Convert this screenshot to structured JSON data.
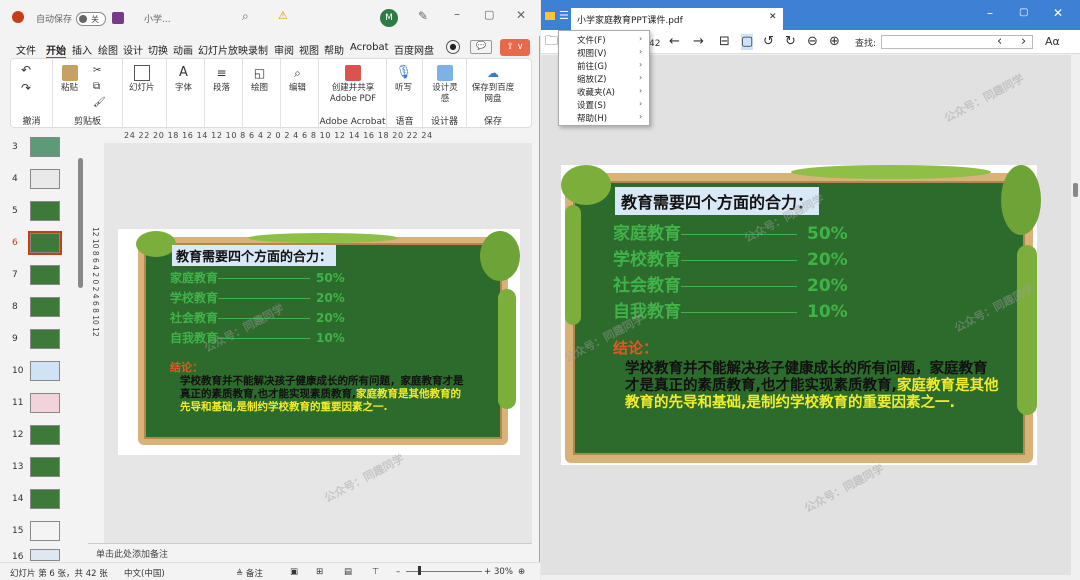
{
  "ppt": {
    "autosave_label": "自动保存",
    "autosave_state": "关",
    "doc_short": "小学...",
    "avatar": "M",
    "tabs": [
      "文件",
      "开始",
      "插入",
      "绘图",
      "设计",
      "切换",
      "动画",
      "幻灯片放映",
      "录制",
      "审阅",
      "视图",
      "帮助",
      "Acrobat",
      "百度网盘"
    ],
    "active_tab": "开始",
    "ribbon": {
      "undo_group": "撤消",
      "clipboard_group": "剪贴板",
      "paste": "粘贴",
      "slides": "幻灯片",
      "font": "字体",
      "paragraph": "段落",
      "drawing": "绘图",
      "editing": "编辑",
      "create_share_pdf": "创建并共享 Adobe PDF",
      "acrobat_group": "Adobe Acrobat",
      "dictate": "听写",
      "voice_group": "语音",
      "designer": "设计灵感",
      "designer_group": "设计器",
      "save_baidu": "保存到百度网盘",
      "save_group": "保存"
    },
    "ruler": "24 22 20 18 16 14 12 10 8 6 4 2 0 2 4 6 8 10 12 14 16 18 20 22 24",
    "vruler": "12 10 8 6 4 2 0 2 4 6 8 10 12",
    "thumbs": [
      "3",
      "4",
      "5",
      "6",
      "7",
      "8",
      "9",
      "10",
      "11",
      "12",
      "13",
      "14",
      "15",
      "16"
    ],
    "active_thumb": "6",
    "notes_placeholder": "单击此处添加备注",
    "status": {
      "slide_info": "幻灯片 第 6 张，共 42 张",
      "language": "中文(中国)",
      "notes": "备注",
      "zoom": "30%"
    }
  },
  "slide": {
    "heading": "教育需要四个方面的合力：",
    "rows": [
      {
        "label": "家庭教育",
        "pct": "50%"
      },
      {
        "label": "学校教育",
        "pct": "20%"
      },
      {
        "label": "社会教育",
        "pct": "20%"
      },
      {
        "label": "自我教育",
        "pct": "10%"
      }
    ],
    "conclusion_label": "结论：",
    "para_1": "学校教育并不能解决孩子健康成长的所有问题，家庭教育才是真正的素质教育,也才能实现素质教育,",
    "para_2": "家庭教育是其他教育的先导和基础,是制约学校教育的重要因素之一."
  },
  "pdf": {
    "tab_title": "小学家庭教育PPT课件.pdf",
    "page_total": "42",
    "search_label": "查找:",
    "menu": [
      {
        "label": "文件(F)"
      },
      {
        "label": "视图(V)"
      },
      {
        "label": "前往(G)"
      },
      {
        "label": "缩放(Z)"
      },
      {
        "label": "收藏夹(A)"
      },
      {
        "label": "设置(S)"
      },
      {
        "label": "帮助(H)"
      }
    ]
  },
  "watermark": "公众号：同趣同学",
  "colors": {
    "board": "#2c6b2b",
    "frame": "#d9b27a",
    "row_green": "#41b24a",
    "conclusion": "#e4552a",
    "highlight": "#f1ec2a",
    "pdf_title_bar": "#3d80d4",
    "ppt_accent": "#c43e1c"
  }
}
